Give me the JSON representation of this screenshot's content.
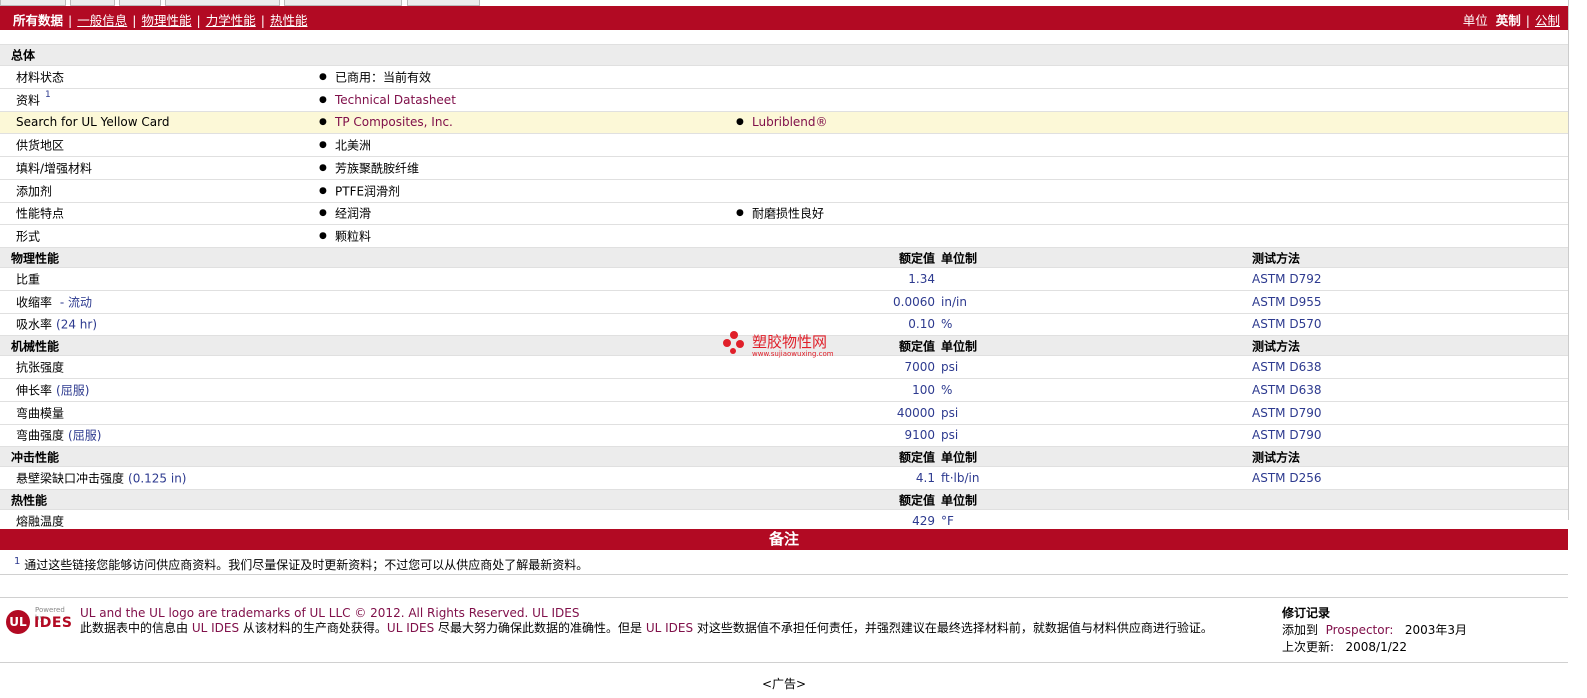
{
  "nav": {
    "all_data": "所有数据",
    "tabs": [
      "一般信息",
      "物理性能",
      "力学性能",
      "热性能"
    ],
    "units_label": "单位",
    "unit_imperial": "英制",
    "unit_metric": "公制"
  },
  "general": {
    "title": "总体",
    "rows": [
      {
        "label": "材料状态",
        "values": [
          "已商用：当前有效"
        ]
      },
      {
        "label": "资料",
        "sup": "1",
        "values": [
          "Technical Datasheet"
        ]
      },
      {
        "label": "Search for UL Yellow Card",
        "values": [
          "TP Composites, Inc.",
          "Lubriblend®"
        ]
      },
      {
        "label": "供货地区",
        "values": [
          "北美洲"
        ]
      },
      {
        "label": "填料/增强材料",
        "values": [
          "芳族聚酰胺纤维"
        ]
      },
      {
        "label": "添加剂",
        "values": [
          "PTFE润滑剂"
        ]
      },
      {
        "label": "性能特点",
        "values": [
          "经润滑",
          "耐磨损性良好"
        ]
      },
      {
        "label": "形式",
        "values": [
          "颗粒料"
        ]
      }
    ]
  },
  "headers": {
    "nominal": "额定值",
    "unit": "单位制",
    "method": "测试方法"
  },
  "sections": [
    {
      "title": "物理性能",
      "has_method": true,
      "rows": [
        {
          "label": "比重",
          "cond": "",
          "value": "1.34",
          "unit": "",
          "method": "ASTM D792"
        },
        {
          "label": "收缩率",
          "cond": " - 流动",
          "value": "0.0060",
          "unit": "in/in",
          "method": "ASTM D955"
        },
        {
          "label": "吸水率",
          "cond": "(24 hr)",
          "value": "0.10",
          "unit": "%",
          "method": "ASTM D570"
        }
      ]
    },
    {
      "title": "机械性能",
      "has_method": true,
      "rows": [
        {
          "label": "抗张强度",
          "cond": "",
          "value": "7000",
          "unit": "psi",
          "method": "ASTM D638"
        },
        {
          "label": "伸长率",
          "cond": "(屈服)",
          "value": "100",
          "unit": "%",
          "method": "ASTM D638"
        },
        {
          "label": "弯曲模量",
          "cond": "",
          "value": "40000",
          "unit": "psi",
          "method": "ASTM D790"
        },
        {
          "label": "弯曲强度",
          "cond": "(屈服)",
          "value": "9100",
          "unit": "psi",
          "method": "ASTM D790"
        }
      ]
    },
    {
      "title": "冲击性能",
      "has_method": true,
      "rows": [
        {
          "label": "悬壁梁缺口冲击强度",
          "cond": "(0.125 in)",
          "value": "4.1",
          "unit": "ft·lb/in",
          "method": "ASTM D256"
        }
      ]
    },
    {
      "title": "热性能",
      "has_method": false,
      "rows": [
        {
          "label": "熔融温度",
          "cond": "",
          "value": "429",
          "unit": "°F",
          "method": ""
        }
      ]
    }
  ],
  "notes": {
    "title": "备注",
    "sup": "1",
    "text": "通过这些链接您能够访问供应商资料。我们尽量保证及时更新资料；不过您可以从供应商处了解最新资料。"
  },
  "footer": {
    "powered_by": "Powered by",
    "logo_text": "IDES",
    "line1": "UL and the UL logo are trademarks of UL LLC © 2012. All Rights Reserved. UL IDES",
    "line2_parts": [
      "此数据表中的信息由 ",
      "UL IDES",
      " 从该材料的生产商处获得。",
      "UL IDES",
      " 尽最大努力确保此数据的准确性。但是 ",
      "UL IDES",
      " 对这些数据值不承担任何责任，并强烈建议在最终选择材料前，就数据值与材料供应商进行验证。"
    ],
    "revision_title": "修订记录",
    "added_label": "添加到",
    "added_source": "Prospector:",
    "added_date": "2003年3月",
    "updated_label": "上次更新:",
    "updated_date": "2008/1/22"
  },
  "ad": "<广告>",
  "watermark": {
    "title": "塑胶物性网",
    "url": "www.sujiaowuxing.com"
  },
  "colors": {
    "brand_red": "#b20a23",
    "link": "#80104a",
    "value_blue": "#2d3a8f"
  }
}
